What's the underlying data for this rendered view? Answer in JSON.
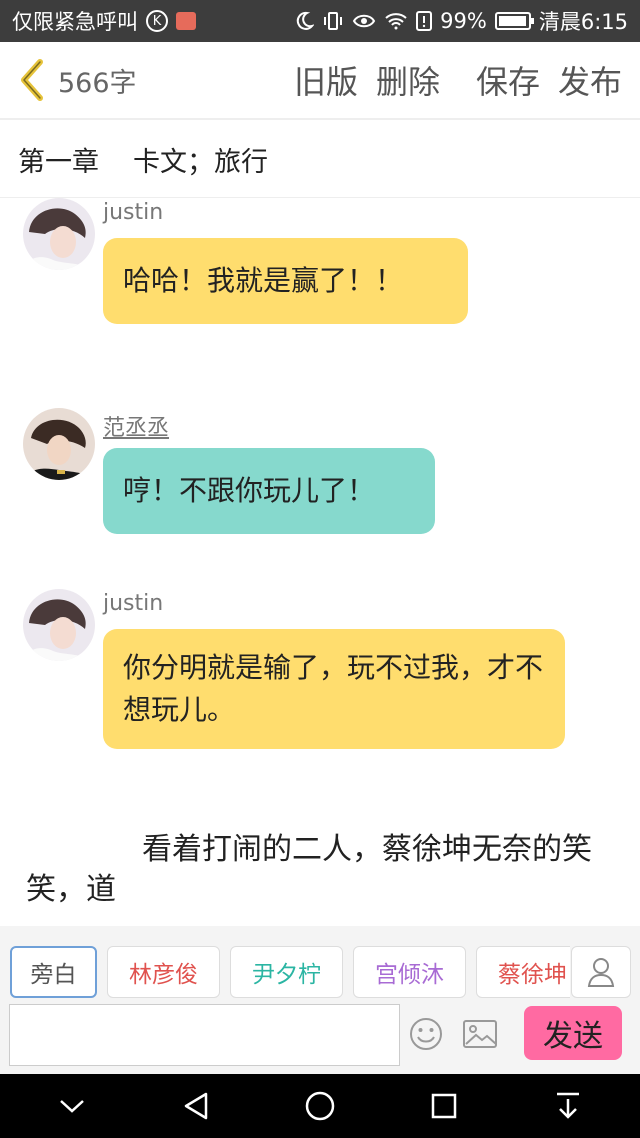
{
  "status_bar": {
    "left_text": "仅限紧急呼叫",
    "k_icon_label": "K",
    "battery_percent": "99%",
    "time": "清晨6:15"
  },
  "toolbar": {
    "word_count": "566字",
    "old_version": "旧版",
    "delete": "删除",
    "save": "保存",
    "publish": "发布"
  },
  "chapter": {
    "number": "第一章",
    "title": "卡文；旅行"
  },
  "messages": [
    {
      "name": "justin",
      "text": "哈哈！我就是赢了！！",
      "color": "#ffdd6e"
    },
    {
      "name": "范丞丞",
      "text": "哼！不跟你玩儿了！",
      "color": "#86d9cd"
    },
    {
      "name": "justin",
      "text": "你分明就是输了，玩不过我，才不想玩儿。",
      "color": "#ffdd6e"
    }
  ],
  "narration": "看着打闹的二人，蔡徐坤无奈的笑笑，道",
  "roles": [
    {
      "label": "旁白",
      "color": "#555555"
    },
    {
      "label": "林彦俊",
      "color": "#e0524e"
    },
    {
      "label": "尹夕柠",
      "color": "#2bb5a3"
    },
    {
      "label": "宫倾沐",
      "color": "#a86bd4"
    },
    {
      "label": "蔡徐坤",
      "color": "#e0524e"
    }
  ],
  "input": {
    "value": "",
    "placeholder": ""
  },
  "send_label": "发送",
  "icons": {
    "back": "chevron-left-icon",
    "person": "person-icon",
    "emoji": "smiley-icon",
    "image": "image-icon"
  }
}
